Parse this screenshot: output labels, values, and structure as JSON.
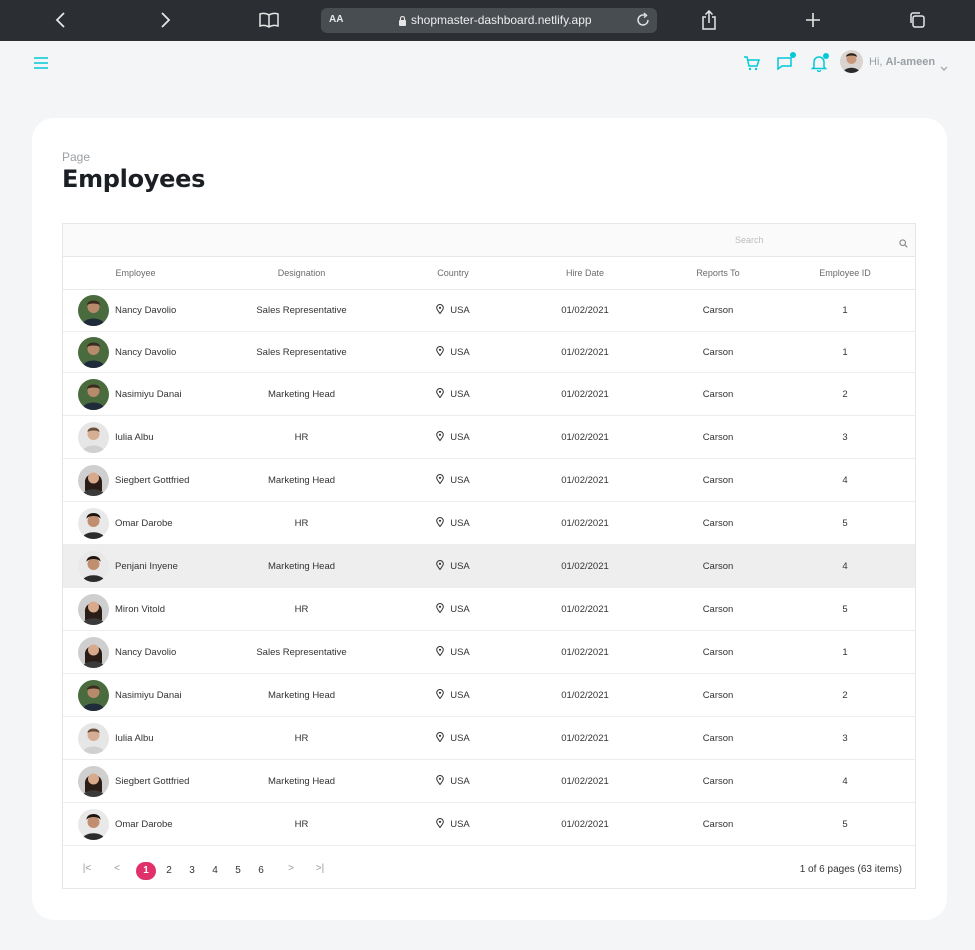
{
  "browser": {
    "text_size_label": "AA",
    "url": "shopmaster-dashboard.netlify.app"
  },
  "header": {
    "greeting": "Hi,",
    "user_name": "Al-ameen",
    "accent_color": "#03c9d7"
  },
  "page": {
    "kicker": "Page",
    "title": "Employees"
  },
  "grid": {
    "search_placeholder": "Search",
    "columns": [
      "Employee",
      "Designation",
      "Country",
      "Hire Date",
      "Reports To",
      "Employee ID"
    ],
    "rows": [
      {
        "name": "Nancy Davolio",
        "designation": "Sales Representative",
        "country": "USA",
        "hire_date": "01/02/2021",
        "reports_to": "Carson",
        "id": "1",
        "avatar": "avatar-green-shirt"
      },
      {
        "name": "Nancy Davolio",
        "designation": "Sales Representative",
        "country": "USA",
        "hire_date": "01/02/2021",
        "reports_to": "Carson",
        "id": "1",
        "avatar": "avatar-green-shirt"
      },
      {
        "name": "Nasimiyu Danai",
        "designation": "Marketing Head",
        "country": "USA",
        "hire_date": "01/02/2021",
        "reports_to": "Carson",
        "id": "2",
        "avatar": "avatar-green-shirt"
      },
      {
        "name": "Iulia Albu",
        "designation": "HR",
        "country": "USA",
        "hire_date": "01/02/2021",
        "reports_to": "Carson",
        "id": "3",
        "avatar": "avatar-light"
      },
      {
        "name": "Siegbert Gottfried",
        "designation": "Marketing Head",
        "country": "USA",
        "hire_date": "01/02/2021",
        "reports_to": "Carson",
        "id": "4",
        "avatar": "avatar-dark-hair"
      },
      {
        "name": "Omar Darobe",
        "designation": "HR",
        "country": "USA",
        "hire_date": "01/02/2021",
        "reports_to": "Carson",
        "id": "5",
        "avatar": "avatar-curly"
      },
      {
        "name": "Penjani Inyene",
        "designation": "Marketing Head",
        "country": "USA",
        "hire_date": "01/02/2021",
        "reports_to": "Carson",
        "id": "4",
        "avatar": "avatar-curly",
        "selected": true
      },
      {
        "name": "Miron Vitold",
        "designation": "HR",
        "country": "USA",
        "hire_date": "01/02/2021",
        "reports_to": "Carson",
        "id": "5",
        "avatar": "avatar-dark-hair"
      },
      {
        "name": "Nancy Davolio",
        "designation": "Sales Representative",
        "country": "USA",
        "hire_date": "01/02/2021",
        "reports_to": "Carson",
        "id": "1",
        "avatar": "avatar-dark-hair"
      },
      {
        "name": "Nasimiyu Danai",
        "designation": "Marketing Head",
        "country": "USA",
        "hire_date": "01/02/2021",
        "reports_to": "Carson",
        "id": "2",
        "avatar": "avatar-green-shirt"
      },
      {
        "name": "Iulia Albu",
        "designation": "HR",
        "country": "USA",
        "hire_date": "01/02/2021",
        "reports_to": "Carson",
        "id": "3",
        "avatar": "avatar-light"
      },
      {
        "name": "Siegbert Gottfried",
        "designation": "Marketing Head",
        "country": "USA",
        "hire_date": "01/02/2021",
        "reports_to": "Carson",
        "id": "4",
        "avatar": "avatar-dark-hair"
      },
      {
        "name": "Omar Darobe",
        "designation": "HR",
        "country": "USA",
        "hire_date": "01/02/2021",
        "reports_to": "Carson",
        "id": "5",
        "avatar": "avatar-curly"
      }
    ]
  },
  "pager": {
    "first": "|<",
    "prev": "<",
    "pages": [
      "1",
      "2",
      "3",
      "4",
      "5",
      "6"
    ],
    "active_page": "1",
    "next": ">",
    "last": ">|",
    "info": "1 of 6 pages (63 items)",
    "active_color": "#e0316b"
  }
}
